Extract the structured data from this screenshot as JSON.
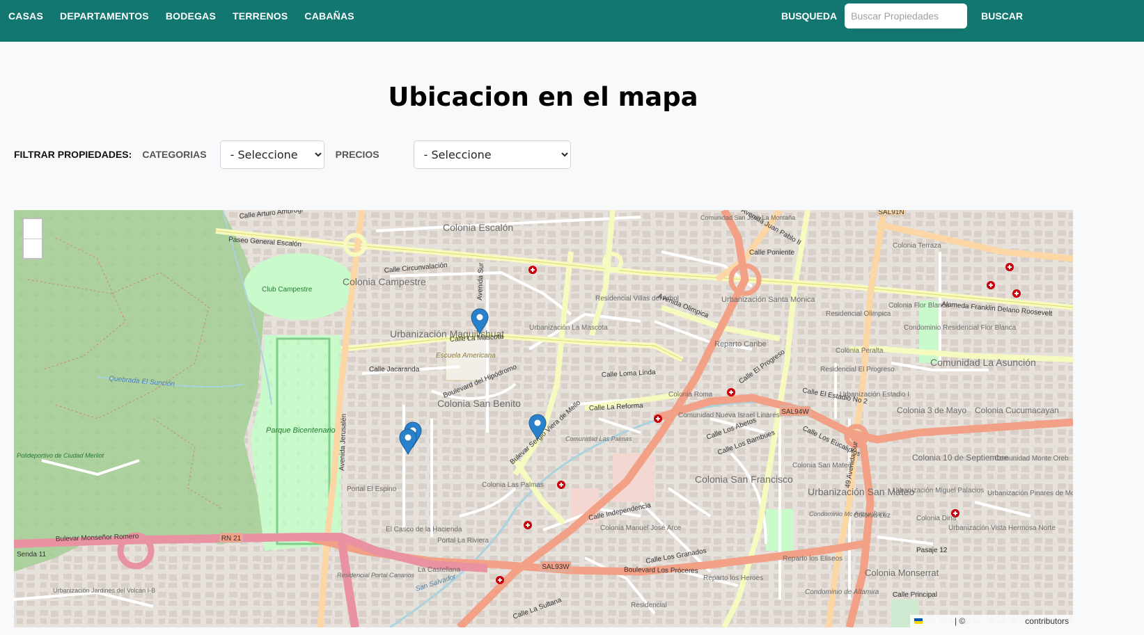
{
  "nav": {
    "links": [
      "CASAS",
      "DEPARTAMENTOS",
      "BODEGAS",
      "TERRENOS",
      "CABAÑAS"
    ],
    "search_label": "BUSQUEDA",
    "search_placeholder": "Buscar Propiedades",
    "search_button": "BUSCAR"
  },
  "page": {
    "title": "Ubicacion en el mapa"
  },
  "filters": {
    "title": "FILTRAR PROPIEDADES:",
    "categories_label": "CATEGORIAS",
    "categories_selected": "- Seleccione",
    "prices_label": "PRECIOS",
    "prices_selected": "- Seleccione"
  },
  "map": {
    "attribution_sep": "| ©",
    "attribution_text": "contributors",
    "marker_count": 4,
    "place_labels": [
      "Colonia Escalón",
      "Colonia Campestre",
      "Club Campestre",
      "Urbanización Maquilishuat",
      "Urbanización La Mascota",
      "Colonia San Benito",
      "Escuela Americana",
      "Parque Bicentenario",
      "Residencial Villas del Arbol",
      "Urbanización Santa Monica",
      "Residencial Olimpica",
      "Colonia Flor Blanca",
      "Condominio Residencial Flor Blanca",
      "Colonia Peralta",
      "Residencial El Progreso",
      "Comunidad La Asunción",
      "Colonia Roma",
      "Reparto Caribe",
      "Urbanización Estadio I",
      "Colonia 3 de Mayo",
      "Colonia Cucumacayan",
      "Comunidad Nueva Israel Linares",
      "Comunidad Las Palmas",
      "Colonia Las Palmas",
      "Colonia San Francisco",
      "Urbanización San Mateo",
      "Colonia San Mateo",
      "Urbanización Miguel Palacios",
      "Colonia 10 de Septiembre",
      "Comunidad Monte Oreb",
      "Urbanización Pinares de Monserrat",
      "Colonia Luz",
      "Colonia Dina",
      "Urbanización Vista Hermosa Norte",
      "Colonia Monserrat",
      "Reparto los Eliseos",
      "Reparto los Heroes",
      "Condominio de Altamira",
      "Colonia Manuel José Arce",
      "Portal El Espino",
      "El Casco de la Hacienda",
      "Portal La Riviera",
      "La Castellana",
      "Residencial Portal Canarios",
      "Urbanización Jardines del Volcán I-B",
      "Polideportivo de Ciudad Merliot",
      "Colonia Terraza",
      "Comunidad San José La Montaña",
      "Condominio Mc Arthur Park",
      "Residencial"
    ],
    "road_labels": [
      "Paseo General Escalón",
      "Calle La Mascota",
      "Alameda Franklin Delano Roosevelt",
      "Avenida Jerusalén",
      "Bulevar Monseñor Romero",
      "Boulevard Los Próceres",
      "Bulevar Sergio Viera de Mello",
      "Boulevard del Hipódromo",
      "Avenida Olimpica",
      "Calle La Reforma",
      "49 Avenida Sur",
      "Calle El Progreso",
      "Avenida Juan Pablo II",
      "Quebrada El Sunción",
      "Calle Jacaranda",
      "Calle Circunvalación",
      "Avenida Sur",
      "Calle Arturo Ambrogi",
      "Calle Loma Linda",
      "Calle Los Granados",
      "Calle Independencia",
      "Calle Principal",
      "Pasaje 12",
      "Calle Poniente",
      "San Salvador",
      "Senda 11",
      "Calle Los Eucaliptos",
      "Calle Los Bambúes",
      "Calle Los Abetos",
      "Calle El Estadio No 2",
      "Calle La Sultana"
    ],
    "route_shields": [
      "RN 21",
      "SAL93W",
      "SAL94W",
      "SAL91N"
    ]
  }
}
